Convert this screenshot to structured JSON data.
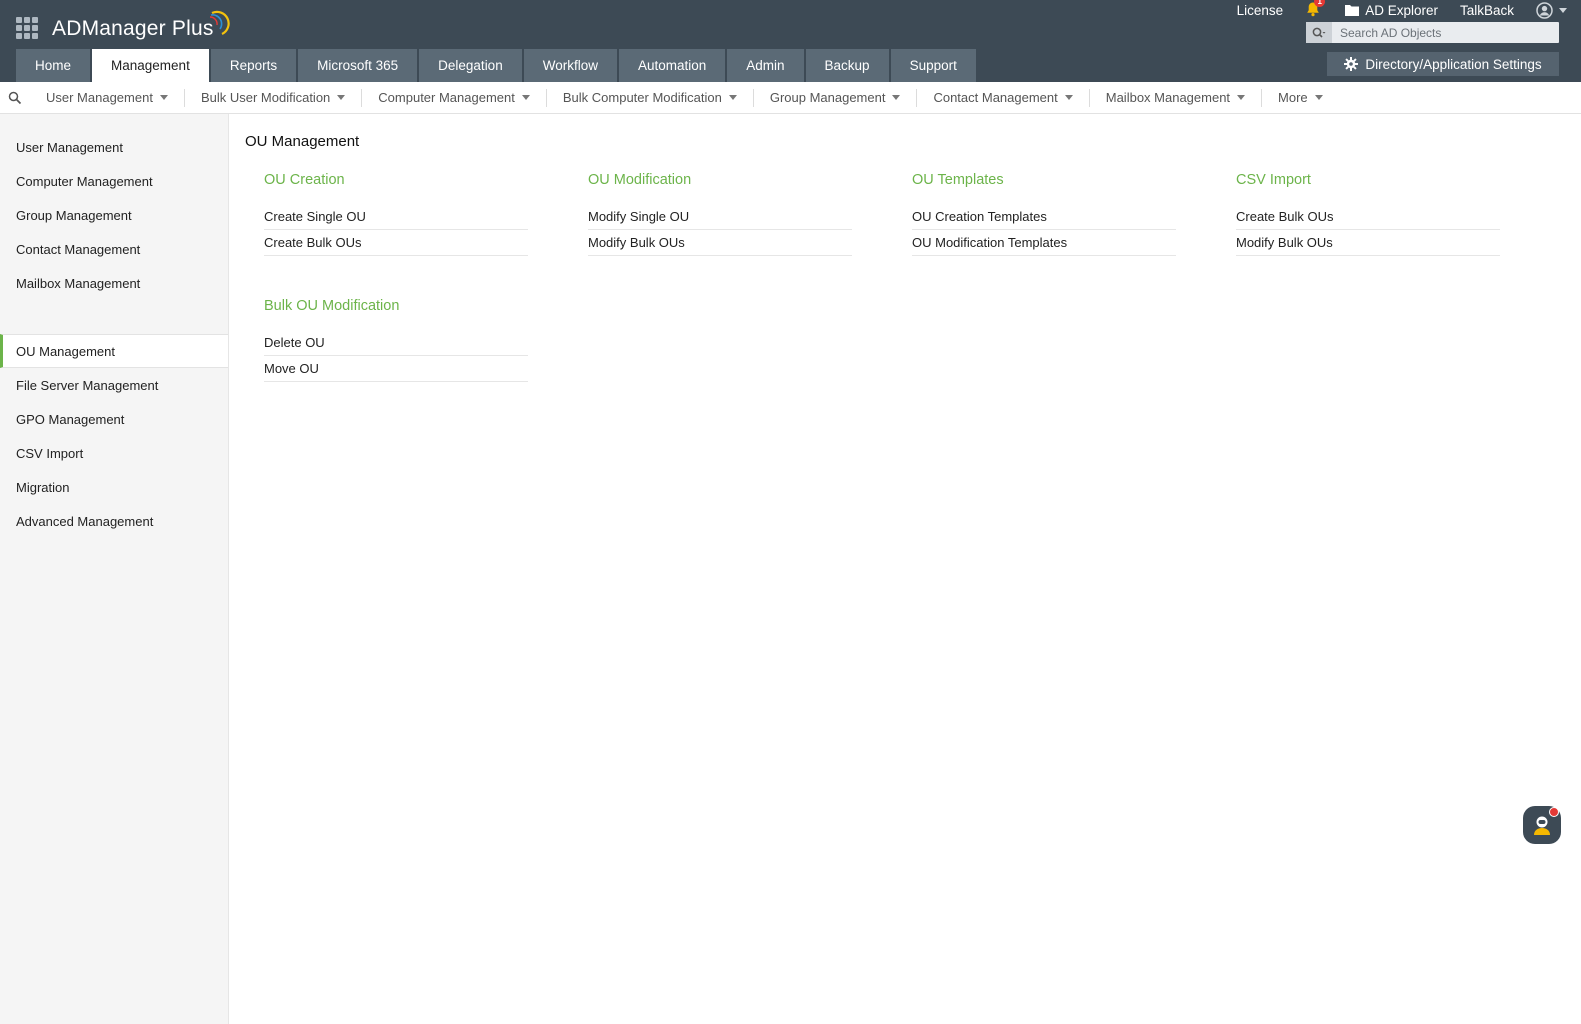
{
  "app": {
    "name": "ADManager Plus"
  },
  "top_links": {
    "license": "License",
    "notifications_count": "1",
    "ad_explorer": "AD Explorer",
    "talkback": "TalkBack"
  },
  "search": {
    "placeholder": "Search AD Objects"
  },
  "main_tabs": [
    {
      "label": "Home"
    },
    {
      "label": "Management"
    },
    {
      "label": "Reports"
    },
    {
      "label": "Microsoft 365"
    },
    {
      "label": "Delegation"
    },
    {
      "label": "Workflow"
    },
    {
      "label": "Automation"
    },
    {
      "label": "Admin"
    },
    {
      "label": "Backup"
    },
    {
      "label": "Support"
    }
  ],
  "active_tab": "Management",
  "settings_button": {
    "label": "Directory/Application Settings"
  },
  "subnav": [
    {
      "label": "User Management"
    },
    {
      "label": "Bulk User Modification"
    },
    {
      "label": "Computer Management"
    },
    {
      "label": "Bulk Computer Modification"
    },
    {
      "label": "Group Management"
    },
    {
      "label": "Contact Management"
    },
    {
      "label": "Mailbox Management"
    },
    {
      "label": "More"
    }
  ],
  "sidebar": {
    "group1": [
      {
        "label": "User Management"
      },
      {
        "label": "Computer Management"
      },
      {
        "label": "Group Management"
      },
      {
        "label": "Contact Management"
      },
      {
        "label": "Mailbox Management"
      }
    ],
    "group2": [
      {
        "label": "OU Management"
      },
      {
        "label": "File Server Management"
      },
      {
        "label": "GPO Management"
      },
      {
        "label": "CSV Import"
      },
      {
        "label": "Migration"
      },
      {
        "label": "Advanced Management"
      }
    ]
  },
  "page": {
    "title": "OU Management",
    "sections": [
      {
        "title": "OU Creation",
        "links": [
          "Create Single OU",
          "Create Bulk OUs"
        ]
      },
      {
        "title": "OU Modification",
        "links": [
          "Modify Single OU",
          "Modify Bulk OUs"
        ]
      },
      {
        "title": "OU Templates",
        "links": [
          "OU Creation Templates",
          "OU Modification Templates"
        ]
      },
      {
        "title": "CSV Import",
        "links": [
          "Create Bulk OUs",
          "Modify Bulk OUs"
        ]
      },
      {
        "title": "Bulk OU Modification",
        "links": [
          "Delete OU",
          "Move OU"
        ]
      }
    ]
  },
  "colors": {
    "header": "#3d4a55",
    "tab": "#5b6a76",
    "accent_green": "#6cb44a",
    "bell": "#f5b800"
  },
  "icons": [
    "apps-grid-icon",
    "bell-icon",
    "folder-icon",
    "user-account-icon",
    "search-icon",
    "gear-icon",
    "chevron-down-icon",
    "chatbot-icon"
  ]
}
